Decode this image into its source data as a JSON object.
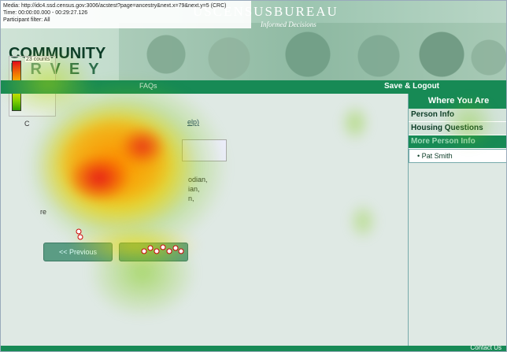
{
  "overlay": {
    "media_line": "Media: http://idc4.ssd.census.gov:3006/acstest?page=ancestry&next.x=79&next.y=5 (CRC)",
    "time_line": "Time: 00:00:00.000 - 00:29:27.126",
    "filter_line": "Participant filter: All",
    "legend_label": "23 counts"
  },
  "header": {
    "title": "USCENSUSBUREAU",
    "tagline": "Informed Decisions",
    "logo_line1": "COMMUNITY",
    "logo_line2": "URVEY"
  },
  "nav": {
    "faqs": "FAQs",
    "logout": "Save & Logout"
  },
  "sidebar": {
    "heading": "Where You Are",
    "items": [
      {
        "label": "Person Info"
      },
      {
        "label": "Housing Questions"
      },
      {
        "label": "More Person Info"
      }
    ],
    "sub_item": "• Pat Smith"
  },
  "main": {
    "help_fragment": "elp)",
    "frag_c": "C",
    "frag1": "odian,",
    "frag2": "ian,",
    "frag3": "n,",
    "frag4": "re",
    "prev_label": "<< Previous",
    "next_label": ""
  },
  "footer": {
    "contact": "Contact Us"
  },
  "colors": {
    "brand_green": "#178a55",
    "panel_bg": "#dfe9e4",
    "heat_red": "#e3001b",
    "heat_yellow": "#ffe600",
    "heat_green": "#2aa000"
  }
}
